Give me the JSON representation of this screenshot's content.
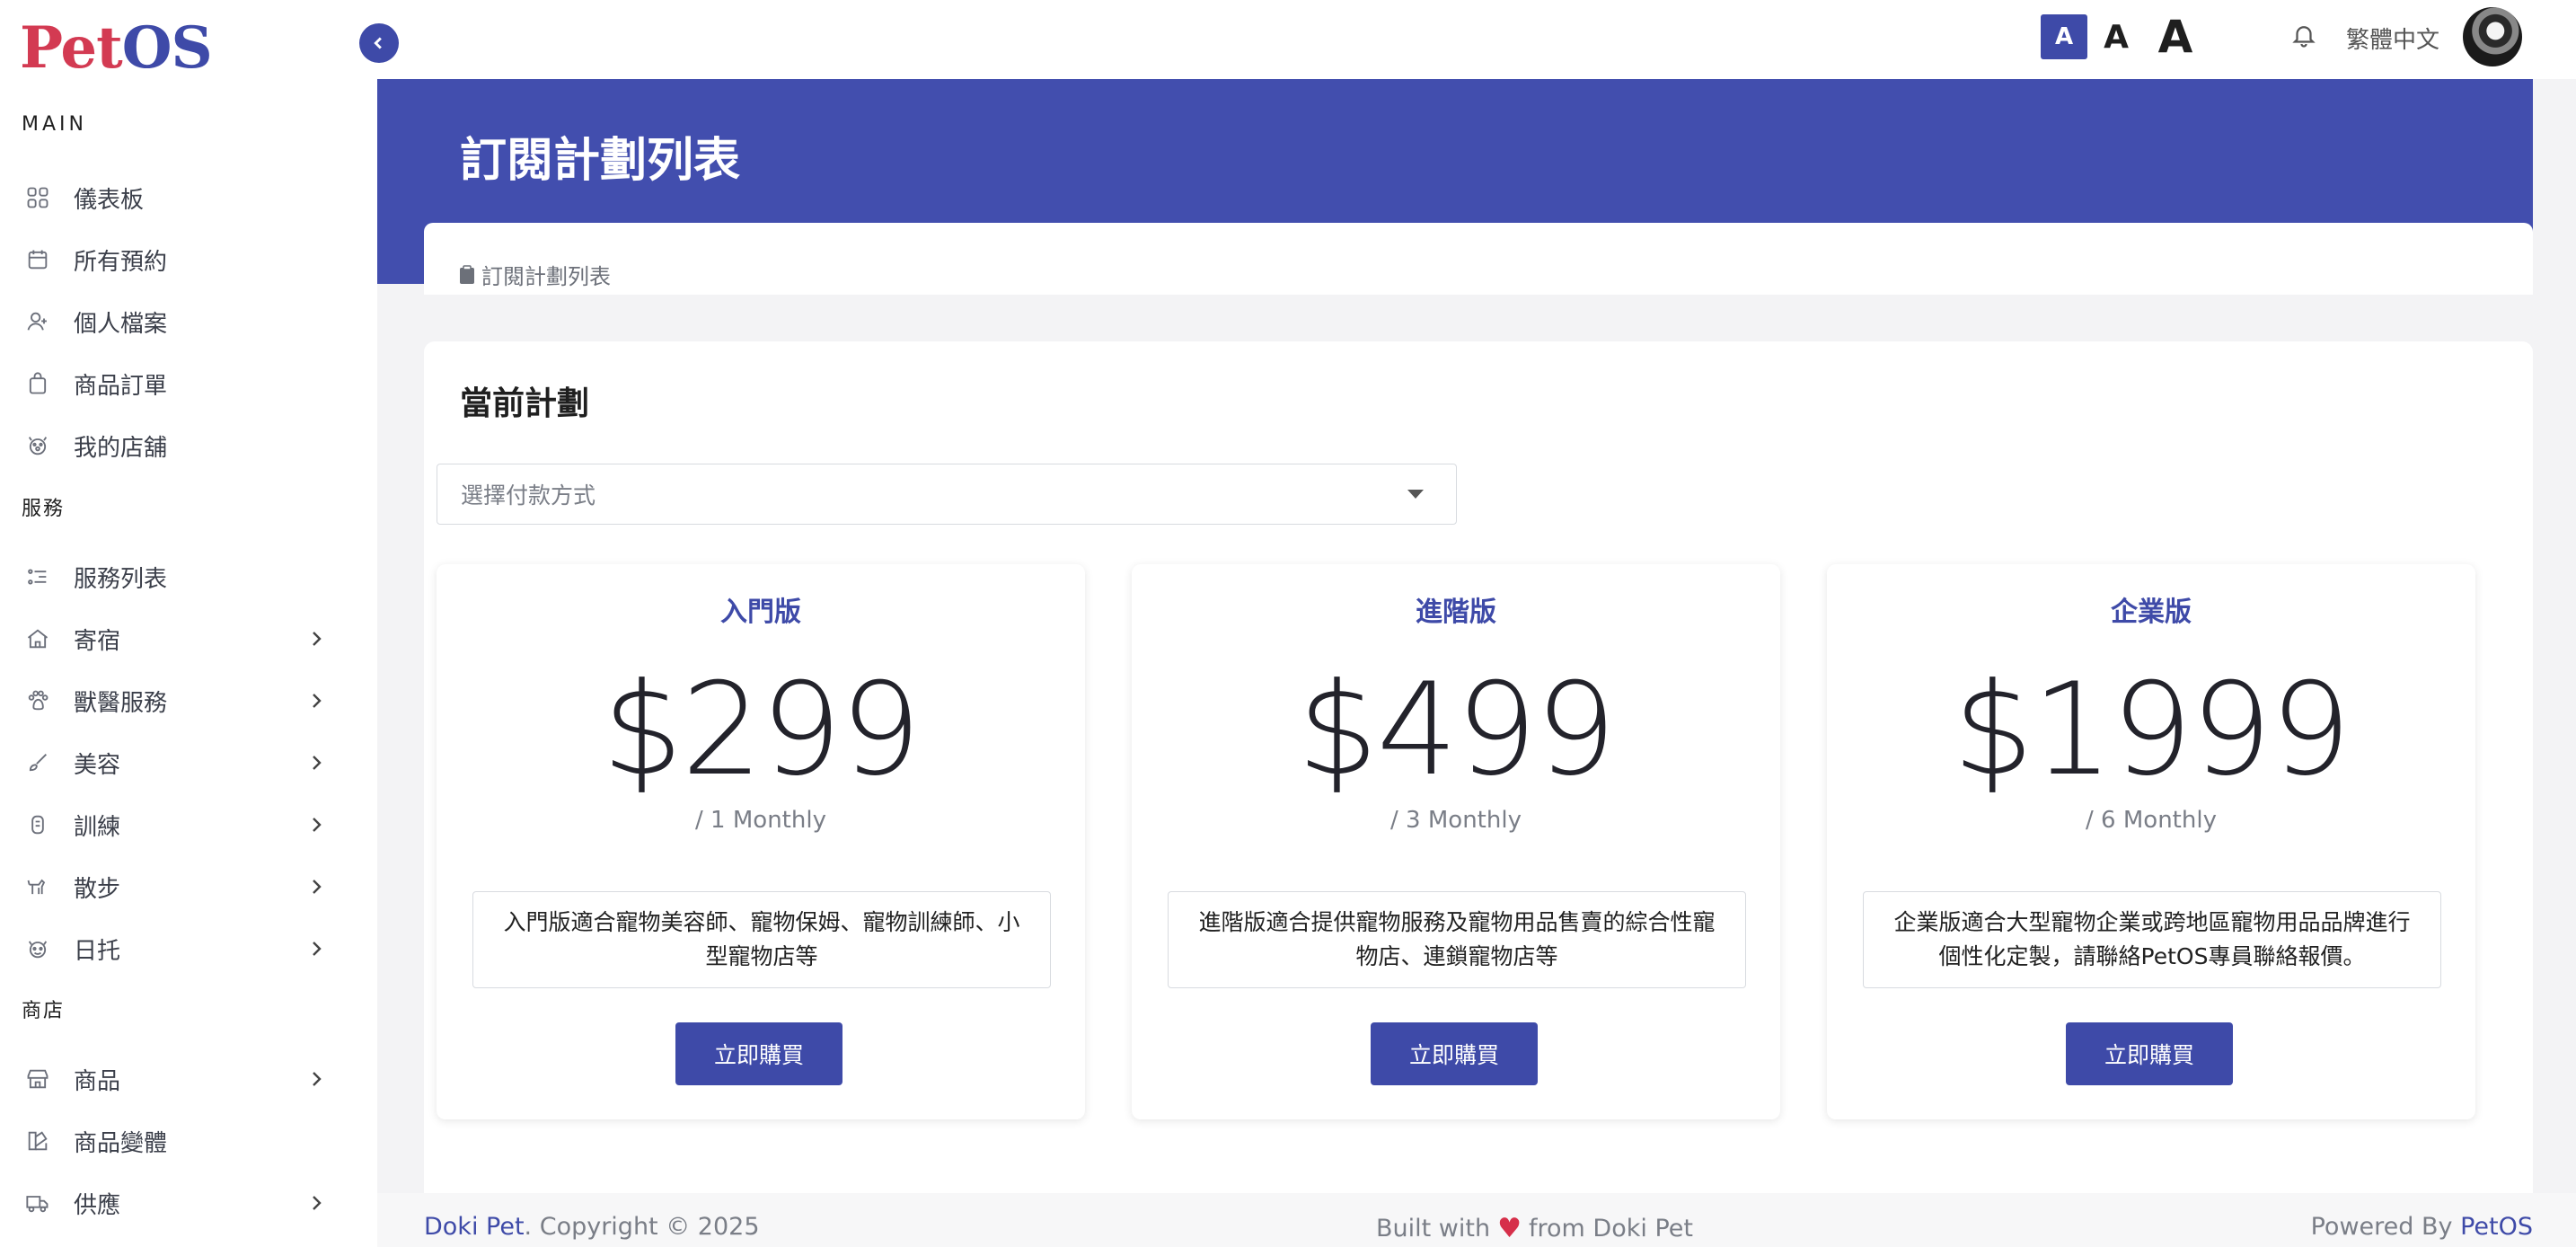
{
  "app": {
    "logo_pet": "Pet",
    "logo_os": "OS"
  },
  "sidebar": {
    "sections": [
      {
        "label": "MAIN"
      },
      {
        "label": "服務"
      },
      {
        "label": "商店"
      }
    ],
    "items": [
      {
        "label": "儀表板",
        "icon": "dashboard-icon"
      },
      {
        "label": "所有預約",
        "icon": "calendar-icon"
      },
      {
        "label": "個人檔案",
        "icon": "user-icon"
      },
      {
        "label": "商品訂單",
        "icon": "shopping-bag-icon"
      },
      {
        "label": "我的店舖",
        "icon": "store-paw-icon"
      },
      {
        "label": "服務列表",
        "icon": "list-icon"
      },
      {
        "label": "寄宿",
        "icon": "house-icon"
      },
      {
        "label": "獸醫服務",
        "icon": "paw-icon"
      },
      {
        "label": "美容",
        "icon": "brush-icon"
      },
      {
        "label": "訓練",
        "icon": "training-icon"
      },
      {
        "label": "散步",
        "icon": "dog-walk-icon"
      },
      {
        "label": "日托",
        "icon": "daycare-icon"
      },
      {
        "label": "商品",
        "icon": "shop-icon"
      },
      {
        "label": "商品變體",
        "icon": "variants-icon"
      },
      {
        "label": "供應",
        "icon": "truck-icon"
      }
    ]
  },
  "topbar": {
    "font_small": "A",
    "font_medium": "A",
    "font_large": "A",
    "language": "繁體中文"
  },
  "page": {
    "title": "訂閱計劃列表",
    "breadcrumb": "訂閱計劃列表"
  },
  "main": {
    "section_title": "當前計劃",
    "payment_select_placeholder": "選擇付款方式",
    "plans": [
      {
        "name": "入門版",
        "price": "$299",
        "period": "/ 1 Monthly",
        "description": "入門版適合寵物美容師、寵物保姆、寵物訓練師、小型寵物店等",
        "button": "立即購買"
      },
      {
        "name": "進階版",
        "price": "$499",
        "period": "/ 3 Monthly",
        "description": "進階版適合提供寵物服務及寵物用品售賣的綜合性寵物店、連鎖寵物店等",
        "button": "立即購買"
      },
      {
        "name": "企業版",
        "price": "$1999",
        "period": "/ 6 Monthly",
        "description": "企業版適合大型寵物企業或跨地區寵物用品品牌進行個性化定製，請聯絡PetOS專員聯絡報價。",
        "button": "立即購買"
      }
    ]
  },
  "footer": {
    "brand_left": "Doki Pet",
    "copyright": ". Copyright © 2025",
    "built_prefix": "Built with",
    "built_suffix": "from Doki Pet",
    "powered_prefix": "Powered By ",
    "powered_brand": "PetOS"
  },
  "colors": {
    "primary": "#3e4aa8",
    "header_band": "#424eae",
    "logo_red": "#d33a52",
    "heart": "#d62f4a"
  }
}
